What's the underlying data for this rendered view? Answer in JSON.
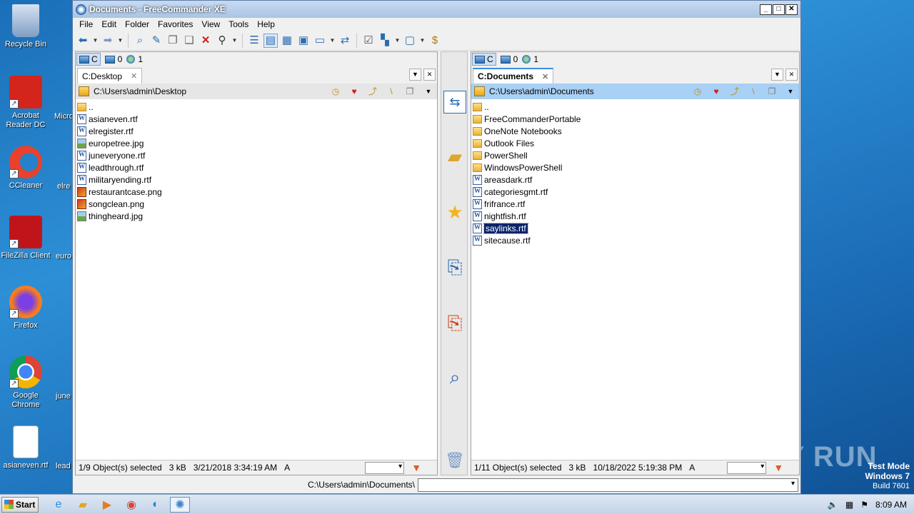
{
  "desktop": {
    "icons": [
      {
        "label": "Recycle Bin",
        "icon": "recycle-bin-icon",
        "color": "#9fb8d8"
      },
      {
        "label": "Acrobat Reader DC",
        "icon": "acrobat-icon",
        "color": "#d4251c"
      },
      {
        "label": "CCleaner",
        "icon": "ccleaner-icon",
        "color": "#e8412d"
      },
      {
        "label": "FileZilla Client",
        "icon": "filezilla-icon",
        "color": "#c0141b"
      },
      {
        "label": "Firefox",
        "icon": "firefox-icon",
        "color": "#f57d1f"
      },
      {
        "label": "Google Chrome",
        "icon": "chrome-icon",
        "color": "#4285f4"
      },
      {
        "label": "asianeven.rtf",
        "icon": "word-doc-icon",
        "color": "#ffffff"
      }
    ],
    "partial_labels": [
      "Micro",
      "elre",
      "euro",
      "june",
      "lead"
    ]
  },
  "window": {
    "title": "Documents - FreeCommander XE",
    "controls": {
      "minimize": "_",
      "maximize": "□",
      "close": "✕"
    }
  },
  "menu": [
    "File",
    "Edit",
    "Folder",
    "Favorites",
    "View",
    "Tools",
    "Help"
  ],
  "left_panel": {
    "drive_label": "C",
    "drive_count_1": "0",
    "drive_count_2": "1",
    "tab_label": "C:Desktop",
    "path": "C:\\Users\\admin\\Desktop",
    "files": [
      {
        "name": "..",
        "type": "folder"
      },
      {
        "name": "asianeven.rtf",
        "type": "rtf"
      },
      {
        "name": "elregister.rtf",
        "type": "rtf"
      },
      {
        "name": "europetree.jpg",
        "type": "jpg"
      },
      {
        "name": "juneveryone.rtf",
        "type": "rtf"
      },
      {
        "name": "leadthrough.rtf",
        "type": "rtf"
      },
      {
        "name": "militaryending.rtf",
        "type": "rtf"
      },
      {
        "name": "restaurantcase.png",
        "type": "png"
      },
      {
        "name": "songclean.png",
        "type": "png"
      },
      {
        "name": "thingheard.jpg",
        "type": "jpg"
      }
    ],
    "status": {
      "selected": "1/9 Object(s) selected",
      "size": "3 kB",
      "date": "3/21/2018 3:34:19 AM",
      "attr": "A"
    }
  },
  "right_panel": {
    "drive_label": "C",
    "drive_count_1": "0",
    "drive_count_2": "1",
    "tab_label": "C:Documents",
    "path": "C:\\Users\\admin\\Documents",
    "files": [
      {
        "name": "..",
        "type": "folder"
      },
      {
        "name": "FreeCommanderPortable",
        "type": "folder"
      },
      {
        "name": "OneNote Notebooks",
        "type": "folder"
      },
      {
        "name": "Outlook Files",
        "type": "folder"
      },
      {
        "name": "PowerShell",
        "type": "folder"
      },
      {
        "name": "WindowsPowerShell",
        "type": "folder"
      },
      {
        "name": "areasdark.rtf",
        "type": "rtf"
      },
      {
        "name": "categoriesgmt.rtf",
        "type": "rtf"
      },
      {
        "name": "frifrance.rtf",
        "type": "rtf"
      },
      {
        "name": "nightfish.rtf",
        "type": "rtf"
      },
      {
        "name": "saylinks.rtf",
        "type": "rtf",
        "selected": true
      },
      {
        "name": "sitecause.rtf",
        "type": "rtf"
      }
    ],
    "status": {
      "selected": "1/11 Object(s) selected",
      "size": "3 kB",
      "date": "10/18/2022 5:19:38 PM",
      "attr": "A"
    }
  },
  "command_line": {
    "label": "C:\\Users\\admin\\Documents\\",
    "value": ""
  },
  "taskbar": {
    "start_label": "Start",
    "time": "8:09 AM"
  },
  "watermark": {
    "line1": "Test Mode",
    "line2": "Windows 7",
    "line3": "Build 7601",
    "brand": "ANY RUN"
  },
  "colors": {
    "selection": "#0a246a",
    "active_path": "#a9d0f5",
    "desktop": "#1f7ac4"
  }
}
